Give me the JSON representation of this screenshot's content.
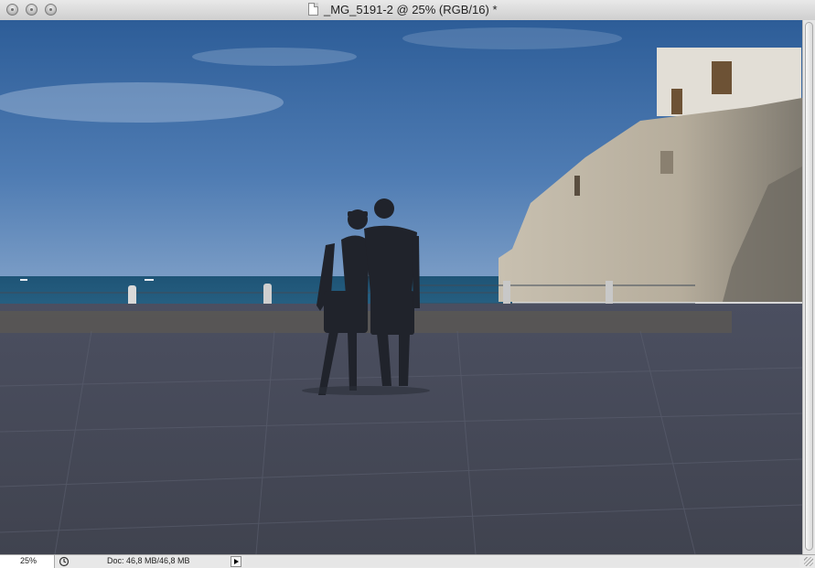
{
  "window": {
    "title": "_MG_5191-2 @ 25% (RGB/16) *",
    "buttons": [
      "close",
      "minimize",
      "zoom"
    ]
  },
  "canvas": {
    "description_icon": "document-icon"
  },
  "statusbar": {
    "zoom": "25%",
    "doc_info": "Doc: 46,8 MB/46,8 MB"
  },
  "colors": {
    "sky_top": "#2f5f9a",
    "sky_horizon": "#6f93bf",
    "sea": "#1f5577",
    "pavement": "#4a4d5d",
    "wall": "#b8b0a0"
  }
}
